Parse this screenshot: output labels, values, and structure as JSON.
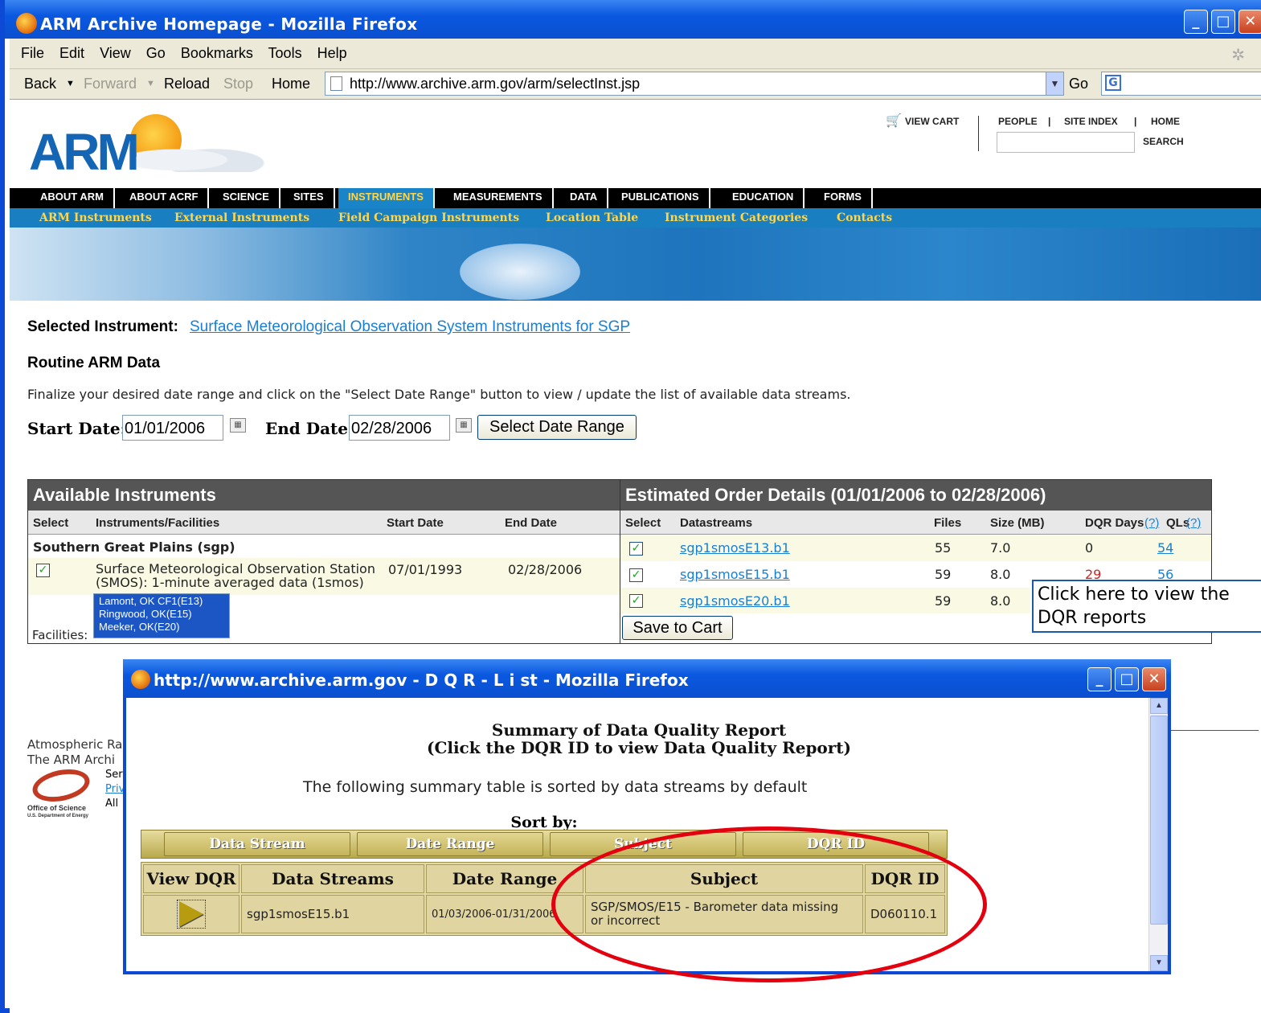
{
  "browser": {
    "title": "ARM Archive Homepage - Mozilla Firefox",
    "menu": [
      "File",
      "Edit",
      "View",
      "Go",
      "Bookmarks",
      "Tools",
      "Help"
    ],
    "nav": {
      "back": "Back",
      "forward": "Forward",
      "reload": "Reload",
      "stop": "Stop",
      "home": "Home",
      "go": "Go"
    },
    "url": "http://www.archive.arm.gov/arm/selectInst.jsp"
  },
  "header": {
    "logo": "ARM",
    "view_cart": "VIEW CART",
    "people": "PEOPLE",
    "sep": "|",
    "site_index": "SITE INDEX",
    "home": "HOME",
    "search": "SEARCH"
  },
  "main_nav": [
    "ABOUT ARM",
    "ABOUT ACRF",
    "SCIENCE",
    "SITES",
    "INSTRUMENTS",
    "MEASUREMENTS",
    "DATA",
    "PUBLICATIONS",
    "EDUCATION",
    "FORMS"
  ],
  "sub_nav": [
    "ARM Instruments",
    "External Instruments",
    "Field Campaign Instruments",
    "Location Table",
    "Instrument Categories",
    "Contacts"
  ],
  "selected": {
    "label": "Selected Instrument:",
    "link": "Surface Meteorological Observation System Instruments for SGP"
  },
  "routine": {
    "heading": "Routine ARM Data",
    "instructions": "Finalize your desired date range and click on the \"Select Date Range\" button to view / update the list of available data streams."
  },
  "dates": {
    "start_label": "Start Date:",
    "start": "01/01/2006",
    "end_label": "End Date:",
    "end": "02/28/2006",
    "button": "Select Date Range"
  },
  "available": {
    "title": "Available Instruments",
    "headers": [
      "Select",
      "Instruments/Facilities",
      "Start Date",
      "End Date"
    ],
    "site": "Southern Great Plains (sgp)",
    "instrument_line1": "Surface Meteorological Observation Station",
    "instrument_line2": "(SMOS): 1-minute averaged data  (1smos)",
    "start": "07/01/1993",
    "end": "02/28/2006",
    "facilities_label": "Facilities:",
    "facilities": [
      "Lamont, OK CF1(E13)",
      "Ringwood, OK(E15)",
      "Meeker, OK(E20)"
    ]
  },
  "order": {
    "title": "Estimated Order Details (01/01/2006 to 02/28/2006)",
    "headers": [
      "Select",
      "Datastreams",
      "Files",
      "Size (MB)",
      "DQR Days",
      "QLs"
    ],
    "help": "(?)",
    "rows": [
      {
        "ds": "sgp1smosE13.b1",
        "files": "55",
        "size": "7.0",
        "dqr": "0",
        "qls": "54"
      },
      {
        "ds": "sgp1smosE15.b1",
        "files": "59",
        "size": "8.0",
        "dqr": "29",
        "qls": "56"
      },
      {
        "ds": "sgp1smosE20.b1",
        "files": "59",
        "size": "8.0",
        "dqr": "",
        "qls": ""
      }
    ],
    "save": "Save to Cart"
  },
  "callout": {
    "line1": "Click here to view the",
    "line2": "DQR reports"
  },
  "footer": {
    "line1": "Atmospheric Ra",
    "line2": "The ARM Archi",
    "s1": "Ser",
    "s2": "Priv",
    "s3": "All",
    "doe1": "Office of Science",
    "doe2": "U.S. Department of Energy"
  },
  "popup": {
    "title": "http://www.archive.arm.gov - D Q R - L i st - Mozilla Firefox",
    "heading1": "Summary of Data Quality Report",
    "heading2": "(Click the DQR ID to view Data Quality Report)",
    "subtitle": "The following summary table is sorted by data streams by default",
    "sort_by": "Sort by:",
    "sort_buttons": [
      "Data Stream",
      "Date Range",
      "Subject",
      "DQR ID"
    ],
    "headers": [
      "View DQR",
      "Data Streams",
      "Date Range",
      "Subject",
      "DQR ID"
    ],
    "row": {
      "stream": "sgp1smosE15.b1",
      "range": "01/03/2006-01/31/2006",
      "subject1": "SGP/SMOS/E15 - Barometer data missing",
      "subject2": "or incorrect",
      "id": "D060110.1"
    }
  },
  "colors": {
    "accent": "#1a7fc0",
    "highlight": "#e3000f",
    "nav_active": "#ffd64a"
  }
}
